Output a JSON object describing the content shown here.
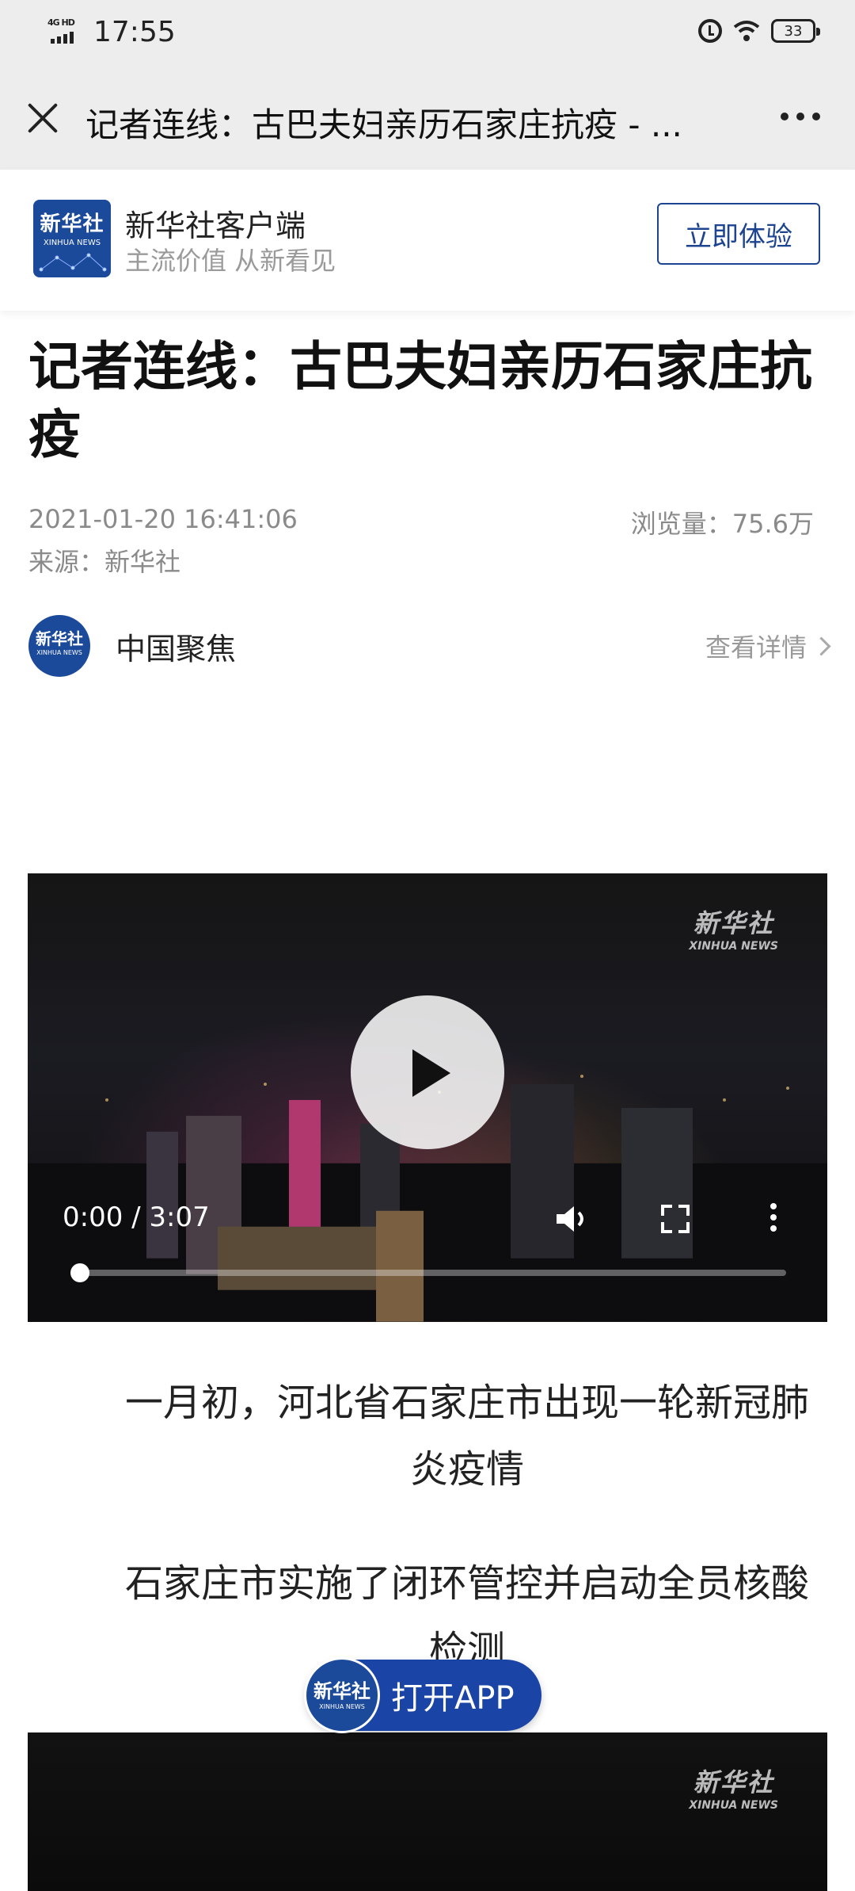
{
  "status_bar": {
    "network": "4G HD",
    "time": "17:55",
    "battery": "33"
  },
  "title_bar": {
    "title": "记者连线：古巴夫妇亲历石家庄抗疫 - ..."
  },
  "app_banner": {
    "app_name": "新华社客户端",
    "slogan": "主流价值 从新看见",
    "cta_label": "立即体验",
    "logo_text": "新华社",
    "logo_subtext": "XINHUA NEWS"
  },
  "article": {
    "title": "记者连线：古巴夫妇亲历石家庄抗疫",
    "date": "2021-01-20 16:41:06",
    "views": "浏览量：75.6万",
    "source": "来源：新华社"
  },
  "author": {
    "name": "中国聚焦",
    "detail_label": "查看详情"
  },
  "video": {
    "watermark": "新华社",
    "watermark_sub": "XINHUA NEWS",
    "time_display": "0:00 / 3:07",
    "progress_fraction": 0
  },
  "paragraphs": [
    "一月初，河北省石家庄市出现一轮新冠肺炎疫情",
    "石家庄市实施了闭环管控并启动全员核酸检测"
  ],
  "open_app": {
    "label": "打开APP"
  },
  "colors": {
    "brand_blue": "#1d4490",
    "bar_gray": "#ededed"
  }
}
